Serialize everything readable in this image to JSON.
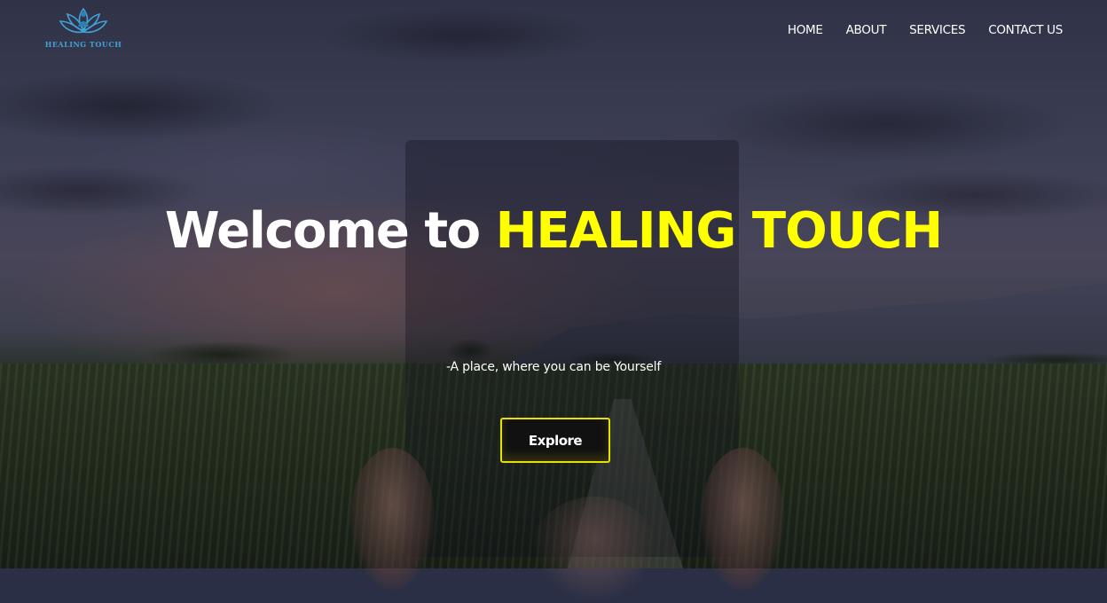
{
  "logo": {
    "text": "HEALING TOUCH",
    "icon": "lotus-meditation-icon",
    "color": "#3fa2d8"
  },
  "nav": {
    "items": [
      {
        "label": "HOME"
      },
      {
        "label": "ABOUT"
      },
      {
        "label": "SERVICES"
      },
      {
        "label": "CONTACT US"
      }
    ]
  },
  "hero": {
    "title_prefix": "Welcome to ",
    "title_brand": "HEALING TOUCH",
    "brand_color": "#ffff00",
    "tagline": "-A place, where you can be Yourself",
    "button_label": "Explore",
    "button_border_color": "#e7e000"
  }
}
